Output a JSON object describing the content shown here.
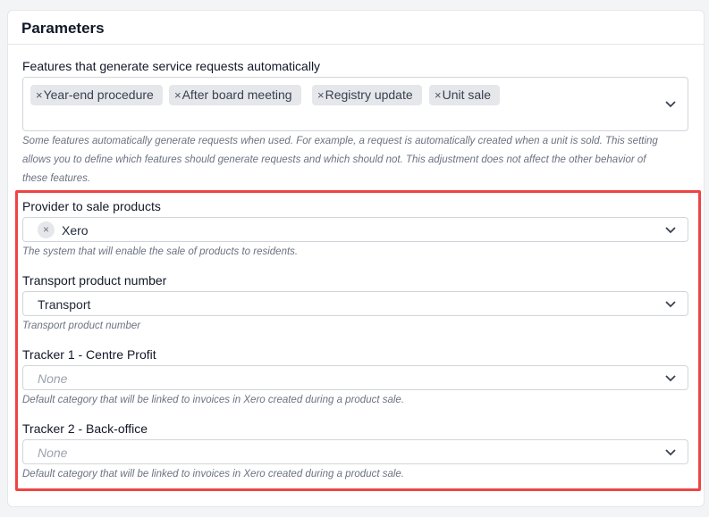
{
  "card": {
    "title": "Parameters"
  },
  "features": {
    "label": "Features that generate service requests automatically",
    "tags": [
      {
        "remove": "×",
        "label": "Year-end procedure"
      },
      {
        "remove": "×",
        "label": "After board meeting"
      },
      {
        "remove": "×",
        "label": "Registry update"
      },
      {
        "remove": "×",
        "label": "Unit sale"
      }
    ],
    "help_line1": "Some features automatically generate requests when used. For example, a request is automatically created when a unit is sold. This setting",
    "help_line2": "allows you to define which features should generate requests and which should not. This adjustment does not affect the other behavior of",
    "help_line3": "these features.",
    "icon": "chevron-down-icon"
  },
  "provider": {
    "label": "Provider to sale products",
    "value": "Xero",
    "clear": "×",
    "help": "The system that will enable the sale of products to residents."
  },
  "transport": {
    "label": "Transport product number",
    "value": "Transport",
    "help": "Transport product number"
  },
  "tracker1": {
    "label": "Tracker 1 - Centre Profit",
    "placeholder": "None",
    "help": "Default category that will be linked to invoices in Xero created during a product sale."
  },
  "tracker2": {
    "label": "Tracker 2 - Back-office",
    "placeholder": "None",
    "help": "Default category that will be linked to invoices in Xero created during a product sale."
  },
  "colors": {
    "highlight": "#ef4444",
    "tag_bg": "#e5e7eb",
    "border": "#d1d5db"
  }
}
